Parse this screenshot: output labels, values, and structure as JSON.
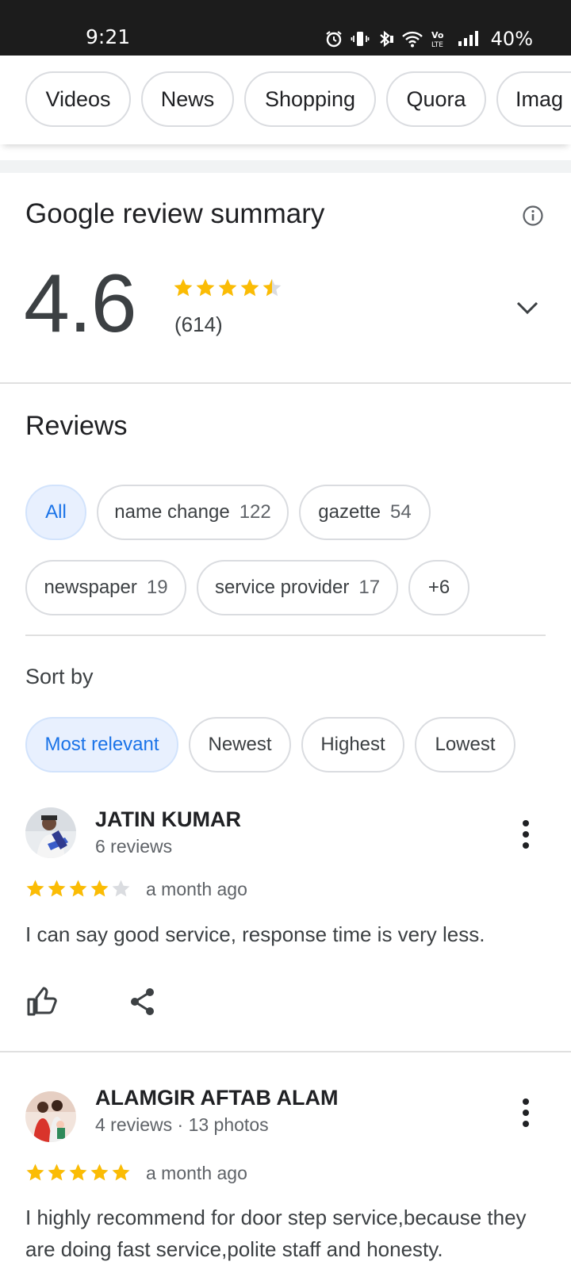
{
  "status_bar": {
    "time": "9:21",
    "battery": "40%",
    "icons": [
      "alarm-icon",
      "vibrate-icon",
      "bluetooth-icon",
      "wifi-icon",
      "volte-icon",
      "signal-icon"
    ]
  },
  "search_tabs": [
    "Videos",
    "News",
    "Shopping",
    "Quora",
    "Imag"
  ],
  "review_summary": {
    "title": "Google review summary",
    "rating": "4.6",
    "rating_value": 4.6,
    "count": "(614)",
    "star_color": "#fbbc04"
  },
  "reviews_section": {
    "title": "Reviews",
    "topics": [
      {
        "label": "All",
        "count": ""
      },
      {
        "label": "name change",
        "count": "122"
      },
      {
        "label": "gazette",
        "count": "54"
      },
      {
        "label": "newspaper",
        "count": "19"
      },
      {
        "label": "service provider",
        "count": "17"
      },
      {
        "label": "+6",
        "count": ""
      }
    ],
    "selected_topic": "All",
    "sort_label": "Sort by",
    "sort_options": [
      "Most relevant",
      "Newest",
      "Highest",
      "Lowest"
    ],
    "selected_sort": "Most relevant"
  },
  "reviews": [
    {
      "name": "JATIN KUMAR",
      "meta": "6 reviews",
      "stars": 4,
      "time": "a month ago",
      "text": "I can say good service, response time is very less."
    },
    {
      "name": "ALAMGIR AFTAB ALAM",
      "meta": "4 reviews · 13 photos",
      "stars": 5,
      "time": "a month ago",
      "text": "I highly recommend for door step service,because they are doing fast service,polite staff and honesty."
    }
  ],
  "colors": {
    "accent_blue": "#1a73e8",
    "chip_selected_bg": "#e8f0fe",
    "star_filled": "#fbbc04",
    "star_empty": "#dadce0"
  }
}
